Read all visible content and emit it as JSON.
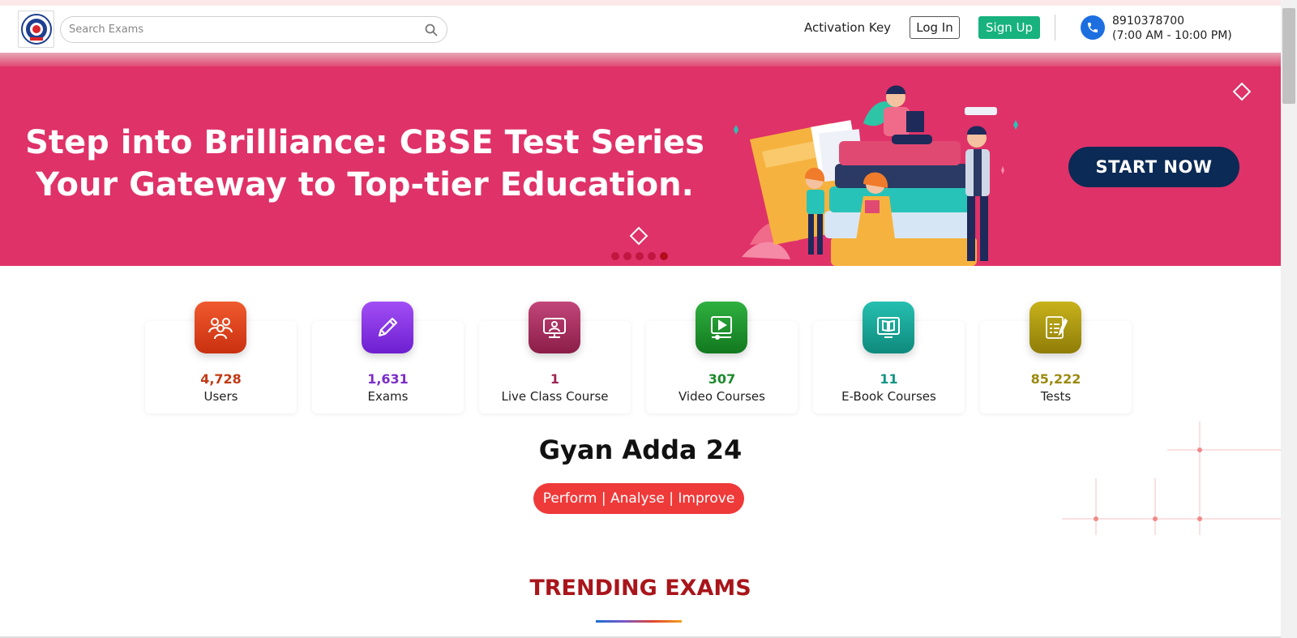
{
  "header": {
    "logo_name": "Gyan Adda 24 logo",
    "search_placeholder": "Search Exams",
    "activation_label": "Activation Key",
    "login_label": "Log In",
    "signup_label": "Sign Up",
    "phone_number": "8910378700",
    "phone_hours": "(7:00 AM - 10:00 PM)"
  },
  "banner": {
    "headline_line1_prefix": "Step into Brilliance: ",
    "headline_line1_bold": "CBSE Test Series",
    "headline_line2": "Your Gateway to Top-tier Education.",
    "cta_label": "START NOW",
    "slides_total": 5,
    "active_slide": 5,
    "bg_color": "#df3268"
  },
  "stats": [
    {
      "value": "4,728",
      "label": "Users",
      "color": "#c03b16",
      "icon": "users-icon"
    },
    {
      "value": "1,631",
      "label": "Exams",
      "color": "#7a2ec9",
      "icon": "pencil-icon"
    },
    {
      "value": "1",
      "label": "Live Class Course",
      "color": "#9c2553",
      "icon": "live-class-icon"
    },
    {
      "value": "307",
      "label": "Video Courses",
      "color": "#1d8a2c",
      "icon": "video-icon"
    },
    {
      "value": "11",
      "label": "E-Book Courses",
      "color": "#119585",
      "icon": "ebook-icon"
    },
    {
      "value": "85,222",
      "label": "Tests",
      "color": "#9b8a10",
      "icon": "test-icon"
    }
  ],
  "brand": {
    "title": "Gyan Adda 24",
    "tagline": "Perform | Analyse | Improve"
  },
  "trending": {
    "title": "TRENDING EXAMS"
  },
  "colors": {
    "accent_green": "#17b27e",
    "phone_blue": "#1d6fe0",
    "cta_navy": "#0b2a55",
    "trending_red": "#a8151b",
    "tagline_red": "#ef3a3a"
  }
}
